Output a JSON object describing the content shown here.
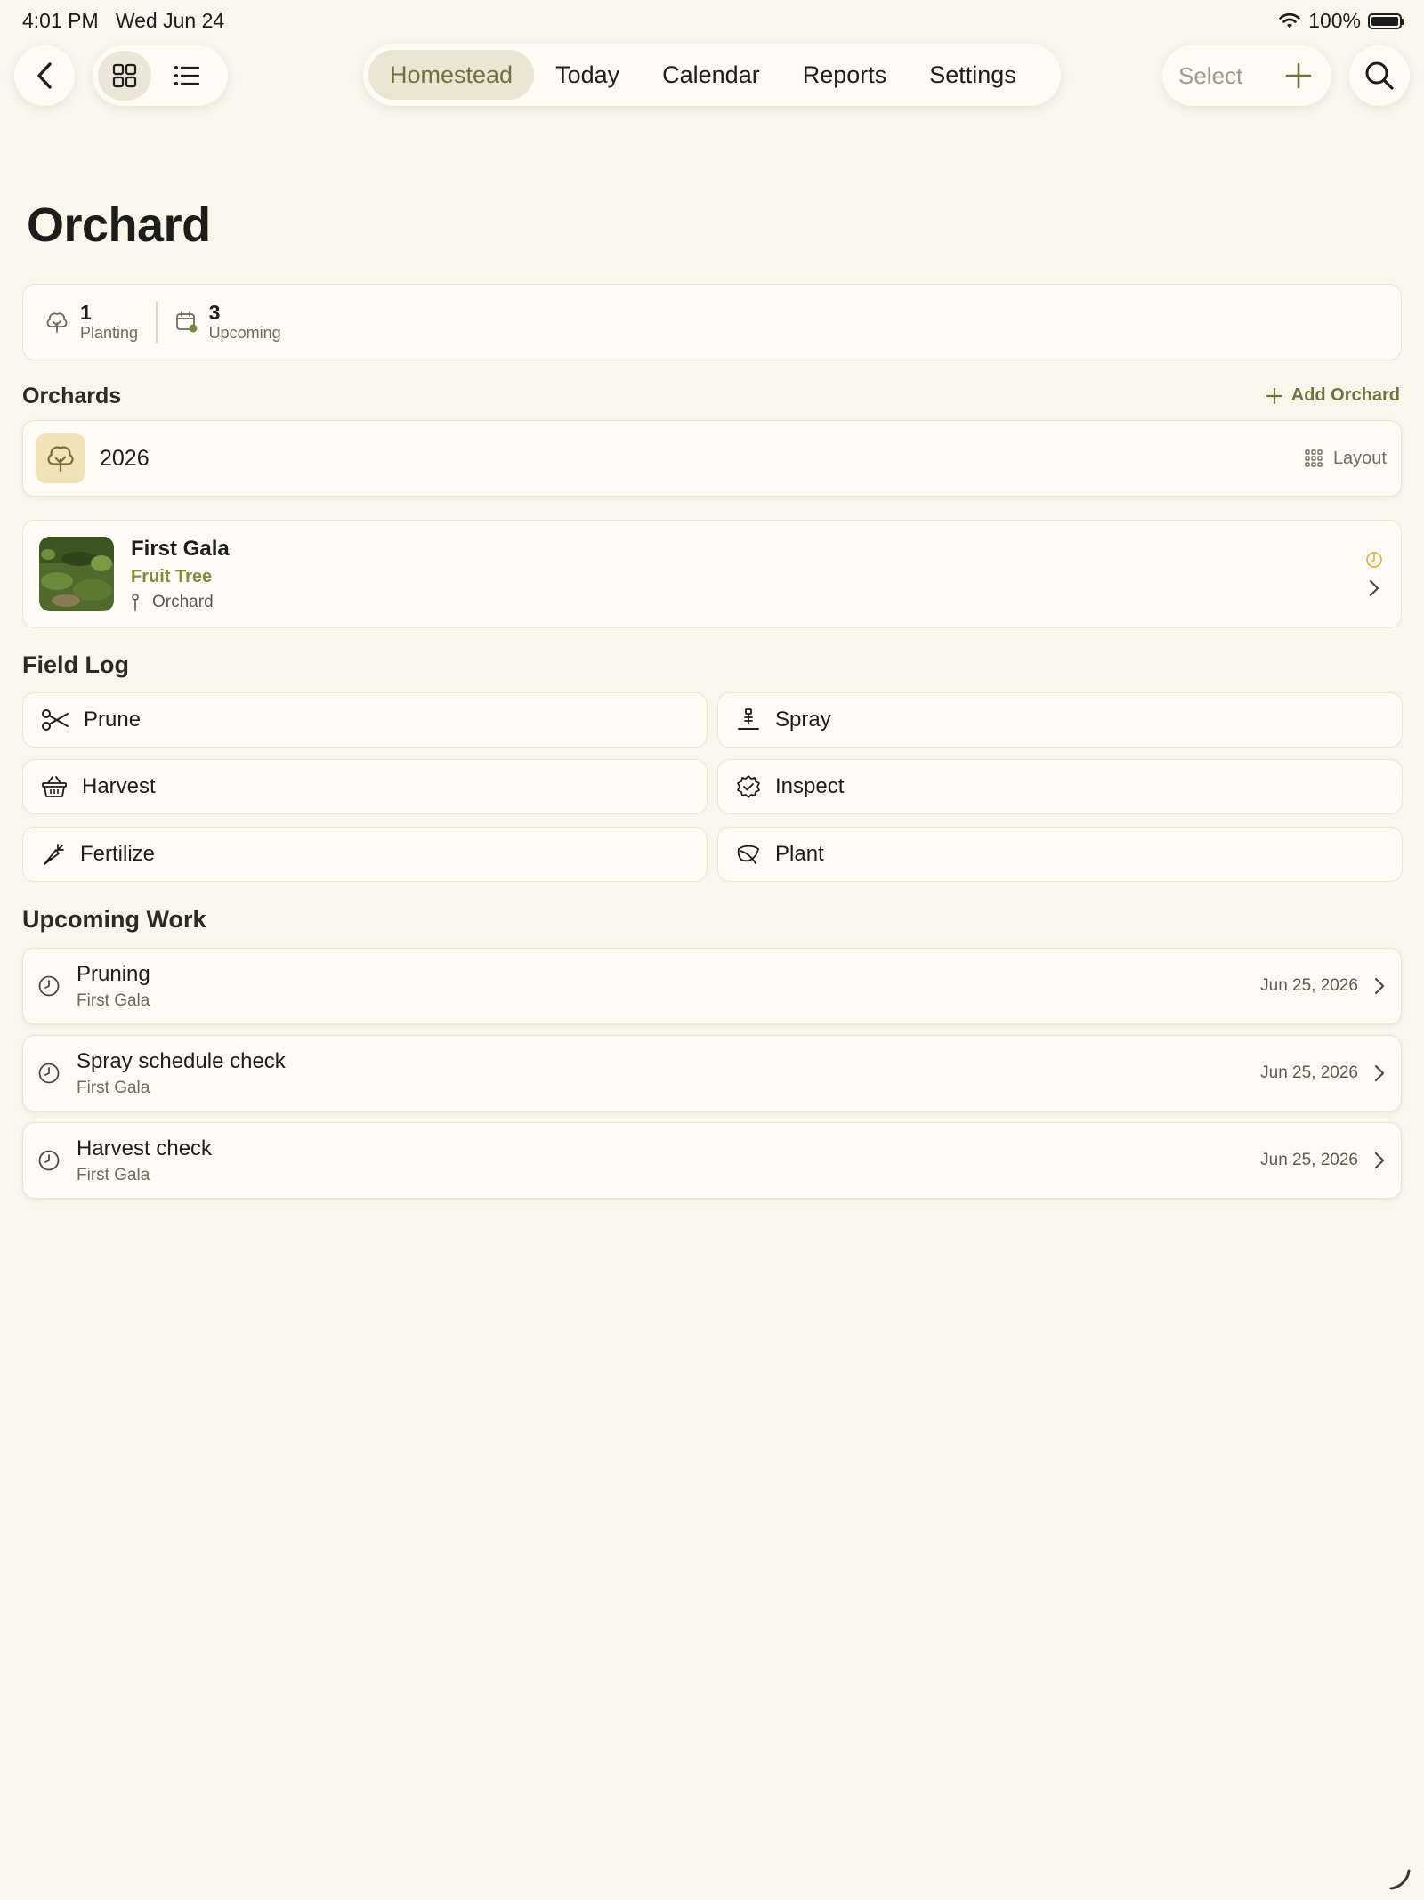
{
  "status_bar": {
    "time": "4:01 PM",
    "date": "Wed Jun 24",
    "battery": "100%"
  },
  "toolbar": {
    "tabs": [
      {
        "label": "Homestead",
        "active": true
      },
      {
        "label": "Today"
      },
      {
        "label": "Calendar"
      },
      {
        "label": "Reports"
      },
      {
        "label": "Settings"
      }
    ],
    "select_label": "Select"
  },
  "page": {
    "title": "Orchard"
  },
  "stats": [
    {
      "value": "1",
      "label": "Planting",
      "icon": "tree-icon"
    },
    {
      "value": "3",
      "label": "Upcoming",
      "icon": "calendar-icon"
    }
  ],
  "orchards": {
    "title": "Orchards",
    "add_label": "Add Orchard",
    "items": [
      {
        "name": "2026",
        "layout_label": "Layout"
      }
    ]
  },
  "tree": {
    "name": "First Gala",
    "type": "Fruit Tree",
    "location": "Orchard"
  },
  "field_log": {
    "title": "Field Log",
    "actions": [
      {
        "label": "Prune",
        "icon": "scissors-icon"
      },
      {
        "label": "Spray",
        "icon": "sprayer-icon"
      },
      {
        "label": "Harvest",
        "icon": "basket-icon"
      },
      {
        "label": "Inspect",
        "icon": "badge-check-icon"
      },
      {
        "label": "Fertilize",
        "icon": "carrot-icon"
      },
      {
        "label": "Plant",
        "icon": "leaf-icon"
      }
    ]
  },
  "upcoming": {
    "title": "Upcoming Work",
    "items": [
      {
        "title": "Pruning",
        "subtitle": "First Gala",
        "date": "Jun 25, 2026"
      },
      {
        "title": "Spray schedule check",
        "subtitle": "First Gala",
        "date": "Jun 25, 2026"
      },
      {
        "title": "Harvest check",
        "subtitle": "First Gala",
        "date": "Jun 25, 2026"
      }
    ]
  },
  "colors": {
    "accent": "#6e7440",
    "background": "#f9f6ec",
    "card": "#fdfbf3",
    "pending": "#e0b64a"
  }
}
